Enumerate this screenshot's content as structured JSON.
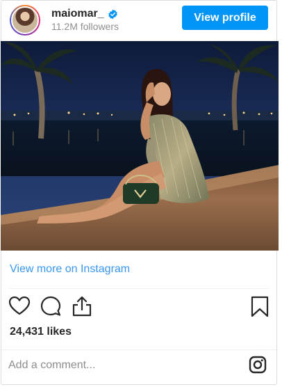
{
  "header": {
    "username": "maiomar_",
    "followers": "11.2M followers",
    "view_profile_label": "View profile"
  },
  "post": {
    "view_more_label": "View more on Instagram",
    "likes": "24,431 likes",
    "comment_placeholder": "Add a comment..."
  },
  "colors": {
    "accent": "#0095f6",
    "link": "#3897f0",
    "muted": "#8e8e8e"
  },
  "icons": {
    "verified": "verified-badge-icon",
    "like": "heart-icon",
    "comment": "comment-icon",
    "share": "share-icon",
    "save": "bookmark-icon",
    "instagram": "instagram-icon"
  }
}
